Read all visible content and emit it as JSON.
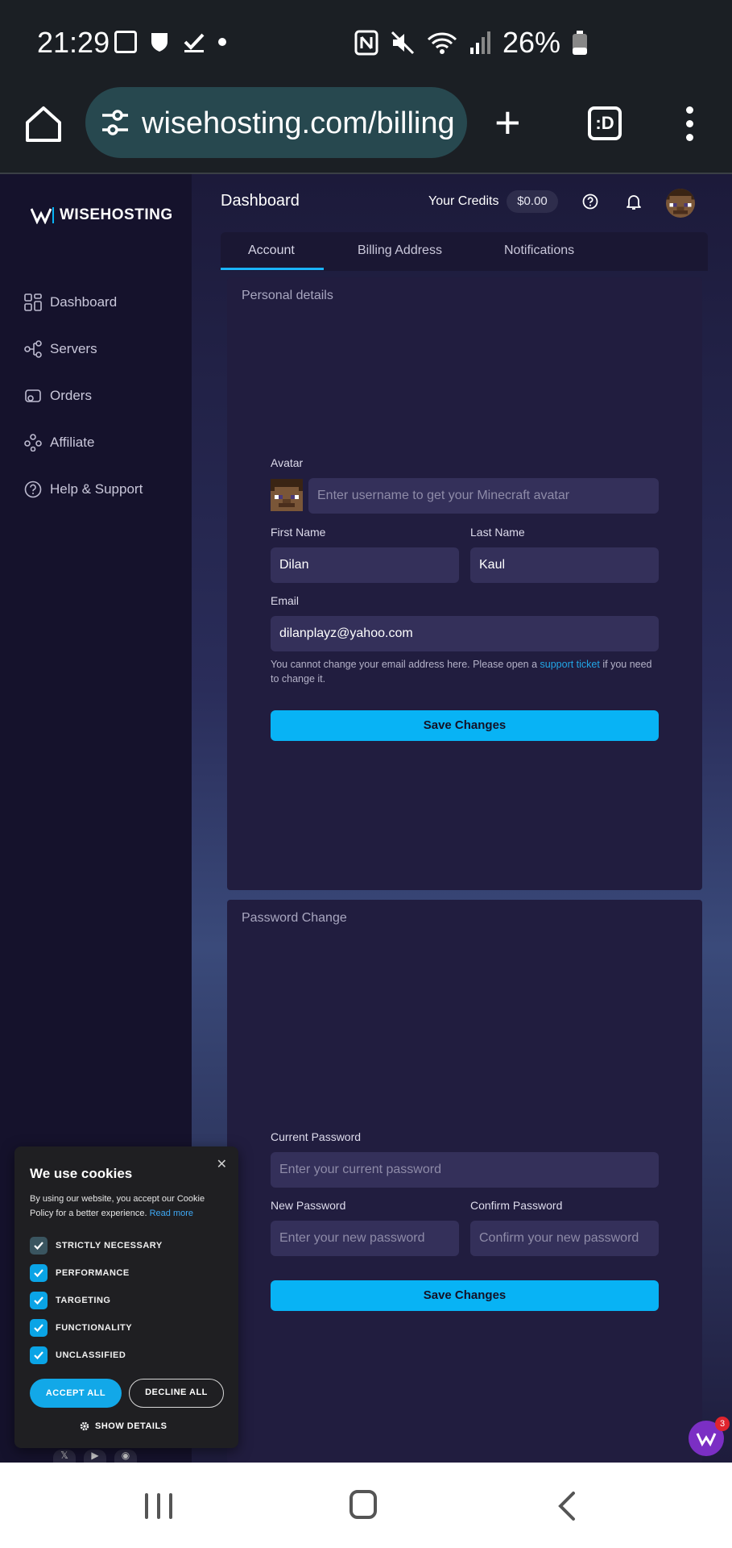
{
  "status_bar": {
    "time": "21:29",
    "battery": "26%"
  },
  "browser": {
    "url": "wisehosting.com/billing",
    "tabs_label": ":D"
  },
  "brand": {
    "logo_text": "WISEHOSTING",
    "accent": "#08b3f5"
  },
  "sidebar": {
    "items": [
      {
        "label": "Dashboard",
        "icon": "dashboard-icon"
      },
      {
        "label": "Servers",
        "icon": "servers-icon"
      },
      {
        "label": "Orders",
        "icon": "orders-icon"
      },
      {
        "label": "Affiliate",
        "icon": "affiliate-icon"
      },
      {
        "label": "Help & Support",
        "icon": "help-icon"
      }
    ]
  },
  "header": {
    "title": "Dashboard",
    "credits_label": "Your Credits",
    "credits_value": "$0.00"
  },
  "tabs": [
    {
      "label": "Account",
      "active": true
    },
    {
      "label": "Billing Address",
      "active": false
    },
    {
      "label": "Notifications",
      "active": false
    }
  ],
  "personal": {
    "title": "Personal details",
    "avatar_label": "Avatar",
    "avatar_placeholder": "Enter username to get your Minecraft avatar",
    "first_name_label": "First Name",
    "first_name_value": "Dilan",
    "last_name_label": "Last Name",
    "last_name_value": "Kaul",
    "email_label": "Email",
    "email_value": "dilanplayz@yahoo.com",
    "email_help_before": "You cannot change your email address here. Please open a",
    "email_help_link": "support ticket",
    "email_help_after": "if you need to change it.",
    "save_label": "Save Changes"
  },
  "password": {
    "title": "Password Change",
    "current_label": "Current Password",
    "current_placeholder": "Enter your current password",
    "new_label": "New Password",
    "new_placeholder": "Enter your new password",
    "confirm_label": "Confirm Password",
    "confirm_placeholder": "Confirm your new password",
    "save_label": "Save Changes"
  },
  "cookies": {
    "title": "We use cookies",
    "description": "By using our website, you accept our Cookie Policy for a better experience.",
    "read_more": "Read more",
    "options": [
      {
        "label": "STRICTLY NECESSARY",
        "checked": true
      },
      {
        "label": "PERFORMANCE",
        "checked": true
      },
      {
        "label": "TARGETING",
        "checked": true
      },
      {
        "label": "FUNCTIONALITY",
        "checked": true
      },
      {
        "label": "UNCLASSIFIED",
        "checked": true
      }
    ],
    "accept_all": "ACCEPT ALL",
    "decline_all": "DECLINE ALL",
    "show_details": "SHOW DETAILS"
  },
  "chat": {
    "badge_count": "3"
  }
}
